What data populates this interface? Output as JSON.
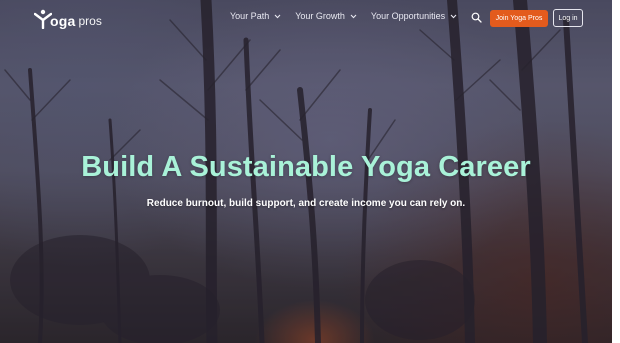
{
  "brand": {
    "word_1": "oga",
    "word_2": "pros"
  },
  "nav": {
    "items": [
      {
        "label": "Your Path"
      },
      {
        "label": "Your Growth"
      },
      {
        "label": "Your Opportunities"
      }
    ],
    "search_icon": "search-icon",
    "join_label": "Join Yoga Pros",
    "login_label": "Log in"
  },
  "hero": {
    "title": "Build A Sustainable Yoga Career",
    "subtitle": "Reduce burnout, build support, and create income you can rely on."
  },
  "colors": {
    "accent": "#e35b1d",
    "headline": "#a9f2d8"
  }
}
